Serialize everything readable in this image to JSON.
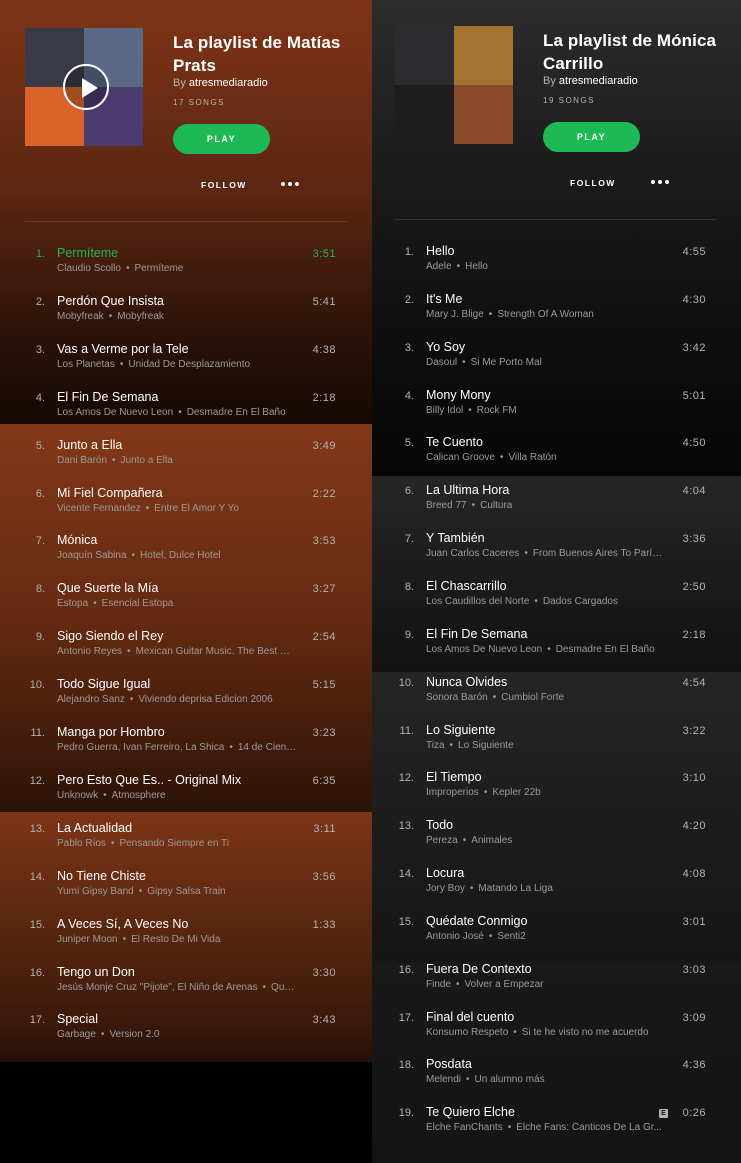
{
  "left": {
    "title": "La playlist de Matías Prats",
    "by_prefix": "By",
    "owner": "atresmediaradio",
    "song_count": "17 SONGS",
    "play_label": "PLAY",
    "follow_label": "FOLLOW",
    "cover_colors": [
      "#3a3a46",
      "#5a6a86",
      "#d9632b",
      "#4a3a6e"
    ],
    "tracks": [
      {
        "num": "1.",
        "name": "Permíteme",
        "artist": "Claudio Scollo",
        "album": "Permíteme",
        "duration": "3:51",
        "active": true
      },
      {
        "num": "2.",
        "name": "Perdón Que Insista",
        "artist": "Mobyfreak",
        "album": "Mobyfreak",
        "duration": "5:41"
      },
      {
        "num": "3.",
        "name": "Vas a Verme por la Tele",
        "artist": "Los Planetas",
        "album": "Unidad De Desplazamiento",
        "duration": "4:38"
      },
      {
        "num": "4.",
        "name": "El Fin De Semana",
        "artist": "Los Amos De Nuevo Leon",
        "album": "Desmadre En El Baño",
        "duration": "2:18"
      },
      {
        "num": "5.",
        "name": "Junto a Ella",
        "artist": "Dani Barón",
        "album": "Junto a Ella",
        "duration": "3:49"
      },
      {
        "num": "6.",
        "name": "Mi Fiel Compañera",
        "artist": "Vicente Fernandez",
        "album": "Entre El Amor Y Yo",
        "duration": "2:22"
      },
      {
        "num": "7.",
        "name": "Mónica",
        "artist": "Joaquín Sabina",
        "album": "Hotel, Dulce Hotel",
        "duration": "3:53"
      },
      {
        "num": "8.",
        "name": "Que Suerte la Mía",
        "artist": "Estopa",
        "album": "Esencial Estopa",
        "duration": "3:27"
      },
      {
        "num": "9.",
        "name": "Sigo Siendo el Rey",
        "artist": "Antonio Reyes",
        "album": "Mexican Guitar Music. The Best Ra...",
        "duration": "2:54"
      },
      {
        "num": "10.",
        "name": "Todo Sigue Igual",
        "artist": "Alejandro Sanz",
        "album": "Viviendo deprisa Edicion 2006",
        "duration": "5:15"
      },
      {
        "num": "11.",
        "name": "Manga por Hombro",
        "artist": "Pedro Guerra, Ivan Ferreiro, La Shica",
        "album": "14 de Ciento...",
        "duration": "3:23"
      },
      {
        "num": "12.",
        "name": "Pero Esto Que Es.. - Original Mix",
        "artist": "Unknowk",
        "album": "Atmosphere",
        "duration": "6:35"
      },
      {
        "num": "13.",
        "name": "La Actualidad",
        "artist": "Pablo Ríos",
        "album": "Pensando Siempre en Ti",
        "duration": "3:11"
      },
      {
        "num": "14.",
        "name": "No Tiene Chiste",
        "artist": "Yumi Gipsy Band",
        "album": "Gipsy Salsa Train",
        "duration": "3:56"
      },
      {
        "num": "15.",
        "name": "A Veces Sí, A Veces No",
        "artist": "Juniper Moon",
        "album": "El Resto De Mi Vida",
        "duration": "1:33"
      },
      {
        "num": "16.",
        "name": "Tengo un Don",
        "artist": "Jesús Monje Cruz \"Pijote\", El Niño de Arenas",
        "album": "Quej...",
        "duration": "3:30"
      },
      {
        "num": "17.",
        "name": "Special",
        "artist": "Garbage",
        "album": "Version 2.0",
        "duration": "3:43"
      }
    ]
  },
  "right": {
    "title": "La playlist de Mónica Carrillo",
    "by_prefix": "By",
    "owner": "atresmediaradio",
    "song_count": "19 SONGS",
    "play_label": "PLAY",
    "follow_label": "FOLLOW",
    "cover_colors": [
      "#2c2c30",
      "#a3742f",
      "#1e1e1e",
      "#8a4a2a"
    ],
    "tracks": [
      {
        "num": "1.",
        "name": "Hello",
        "artist": "Adele",
        "album": "Hello",
        "duration": "4:55"
      },
      {
        "num": "2.",
        "name": "It's Me",
        "artist": "Mary J. Blige",
        "album": "Strength Of A Woman",
        "duration": "4:30"
      },
      {
        "num": "3.",
        "name": "Yo Soy",
        "artist": "Dasoul",
        "album": "Si Me Porto Mal",
        "duration": "3:42"
      },
      {
        "num": "4.",
        "name": "Mony Mony",
        "artist": "Billy Idol",
        "album": "Rock FM",
        "duration": "5:01"
      },
      {
        "num": "5.",
        "name": "Te Cuento",
        "artist": "Calican Groove",
        "album": "Villa Ratón",
        "duration": "4:50"
      },
      {
        "num": "6.",
        "name": "La Ultima Hora",
        "artist": "Breed 77",
        "album": "Cultura",
        "duration": "4:04"
      },
      {
        "num": "7.",
        "name": "Y También",
        "artist": "Juan Carlos Caceres",
        "album": "From Buenos Aires To París (...",
        "duration": "3:36"
      },
      {
        "num": "8.",
        "name": "El Chascarrillo",
        "artist": "Los Caudillos del Norte",
        "album": "Dados Cargados",
        "duration": "2:50"
      },
      {
        "num": "9.",
        "name": "El Fin De Semana",
        "artist": "Los Amos De Nuevo Leon",
        "album": "Desmadre En El Baño",
        "duration": "2:18"
      },
      {
        "num": "10.",
        "name": "Nunca Olvides",
        "artist": "Sonora Barón",
        "album": "Cumbiol Forte",
        "duration": "4:54"
      },
      {
        "num": "11.",
        "name": "Lo Siguiente",
        "artist": "Tiza",
        "album": "Lo Siguiente",
        "duration": "3:22"
      },
      {
        "num": "12.",
        "name": "El Tiempo",
        "artist": "Improperios",
        "album": "Kepler 22b",
        "duration": "3:10"
      },
      {
        "num": "13.",
        "name": "Todo",
        "artist": "Pereza",
        "album": "Animales",
        "duration": "4:20"
      },
      {
        "num": "14.",
        "name": "Locura",
        "artist": "Jory Boy",
        "album": "Matando La Liga",
        "duration": "4:08"
      },
      {
        "num": "15.",
        "name": "Quédate Conmigo",
        "artist": "Antonio José",
        "album": "Senti2",
        "duration": "3:01"
      },
      {
        "num": "16.",
        "name": "Fuera De Contexto",
        "artist": "Finde",
        "album": "Volver a Empezar",
        "duration": "3:03"
      },
      {
        "num": "17.",
        "name": "Final del cuento",
        "artist": "Konsumo Respeto",
        "album": "Si te he visto no me acuerdo",
        "duration": "3:09"
      },
      {
        "num": "18.",
        "name": "Posdata",
        "artist": "Melendi",
        "album": "Un alumno más",
        "duration": "4:36"
      },
      {
        "num": "19.",
        "name": "Te Quiero Elche",
        "artist": "Elche FanChants",
        "album": "Elche Fans: Canticos De La Gr...",
        "duration": "0:26",
        "explicit": true
      }
    ]
  },
  "icons": {
    "explicit_glyph": "E",
    "more_icon": "more-options-icon",
    "play_overlay_icon": "play-icon"
  }
}
